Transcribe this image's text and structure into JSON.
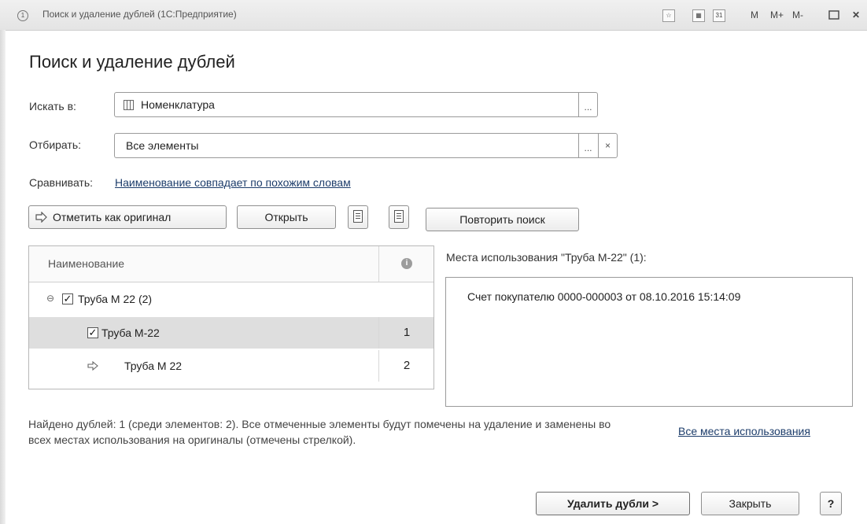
{
  "window": {
    "title": "Поиск и удаление дублей  (1С:Предприятие)",
    "toolbar": [
      "M",
      "M+",
      "M-"
    ]
  },
  "page_title": "Поиск и удаление дублей",
  "search_in": {
    "label": "Искать в:",
    "value": "Номенклатура",
    "choose_label": "..."
  },
  "filter": {
    "label": "Отбирать:",
    "value": "Все элементы",
    "choose_label": "...",
    "clear_label": "×"
  },
  "compare": {
    "label": "Сравнивать:",
    "value": "Наименование совпадает по похожим словам"
  },
  "buttons": {
    "mark_original": "Отметить как оригинал",
    "open": "Открыть",
    "repeat_search": "Повторить поиск",
    "delete_duplicates": "Удалить дубли >",
    "close": "Закрыть",
    "help": "?"
  },
  "table": {
    "header_name": "Наименование",
    "group": {
      "label": "Труба М 22 (2)"
    },
    "rows": [
      {
        "name": "Труба М-22",
        "count": "1"
      },
      {
        "name": "Труба М 22",
        "count": "2"
      }
    ]
  },
  "usage": {
    "title": "Места использования \"Труба М-22\" (1):",
    "items": [
      "Счет покупателю 0000-000003 от 08.10.2016 15:14:09"
    ]
  },
  "footer_note": "Найдено дублей: 1 (среди элементов: 2). Все отмеченные элементы будут помечены на удаление и заменены во всех местах использования на оригиналы (отмечены стрелкой).",
  "all_usage_link": "Все места использования"
}
